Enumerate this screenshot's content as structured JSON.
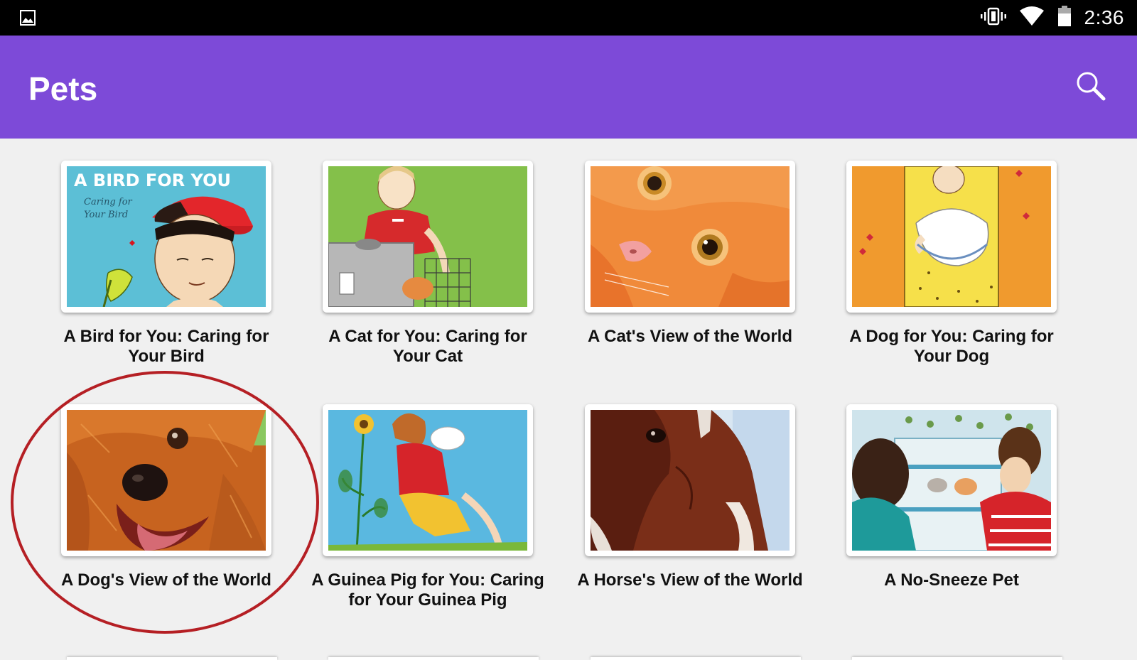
{
  "status_bar": {
    "time": "2:36",
    "left_icon": "gallery-image-icon",
    "right_icons": [
      "vibrate-icon",
      "wifi-icon",
      "battery-icon"
    ]
  },
  "app_bar": {
    "title": "Pets",
    "search_icon": "search-icon",
    "color": "#7d4ad8"
  },
  "books": [
    {
      "title": "A Bird for You: Caring for Your Bird",
      "cover_text": "A BIRD FOR YOU",
      "cover_subtext": "Caring for Your Bird"
    },
    {
      "title": "A Cat for You: Caring for Your Cat"
    },
    {
      "title": "A Cat's View of the World"
    },
    {
      "title": "A Dog for You: Caring for Your Dog"
    },
    {
      "title": "A Dog's View of the World",
      "highlighted": true
    },
    {
      "title": "A Guinea Pig for You: Caring for Your Guinea Pig"
    },
    {
      "title": "A Horse's View of the World"
    },
    {
      "title": "A No-Sneeze Pet"
    }
  ],
  "highlight_color": "#b51f24"
}
